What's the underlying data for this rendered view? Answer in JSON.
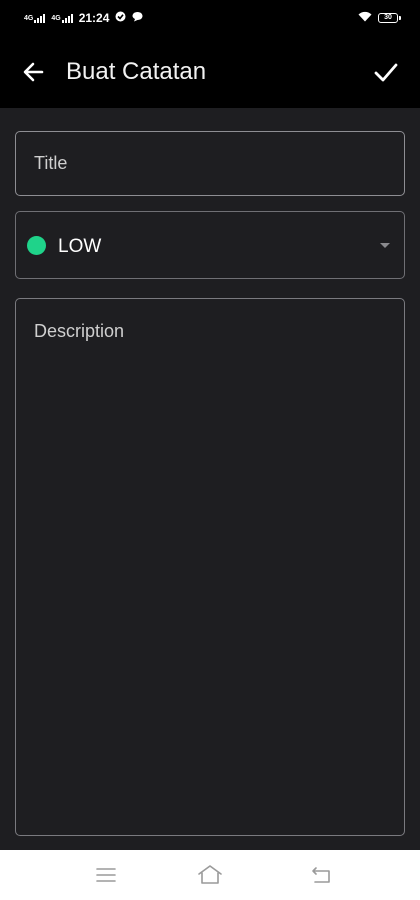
{
  "status_bar": {
    "signal_1": "4G",
    "signal_2": "4G",
    "time": "21:24",
    "battery": "30"
  },
  "app_bar": {
    "title": "Buat Catatan",
    "back_icon": "arrow-left-icon",
    "confirm_icon": "check-icon"
  },
  "form": {
    "title_placeholder": "Title",
    "priority": {
      "selected": "LOW",
      "color": "#1fd38a"
    },
    "description_placeholder": "Description"
  },
  "colors": {
    "background": "#1e1e21",
    "app_bar": "#000000",
    "accent_low": "#1fd38a"
  },
  "nav_bar": {
    "icons": [
      "menu-icon",
      "home-icon",
      "back-icon"
    ]
  }
}
